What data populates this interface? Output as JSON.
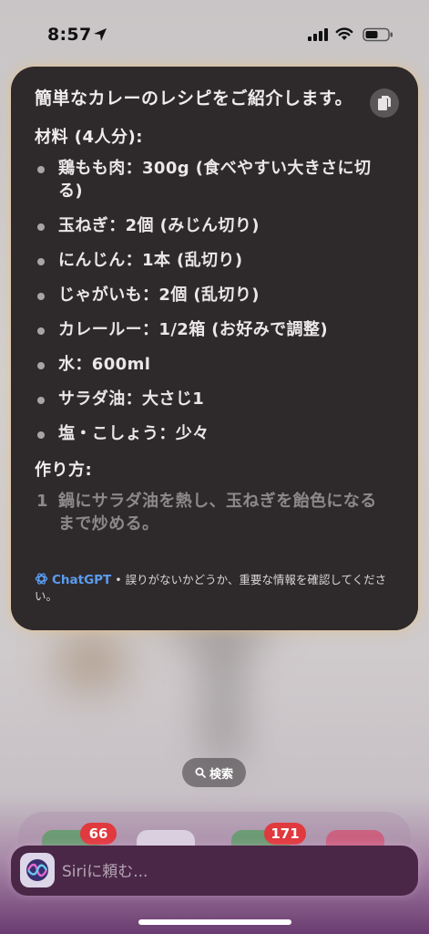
{
  "status_bar": {
    "time": "8:57"
  },
  "response": {
    "intro": "簡単なカレーのレシピをご紹介します。",
    "ingredients_heading": "材料 (4人分):",
    "ingredients": [
      "鶏もも肉：300g (食べやすい大きさに切る)",
      "玉ねぎ：2個 (みじん切り)",
      "にんじん：1本 (乱切り)",
      "じゃがいも：2個 (乱切り)",
      "カレールー：1/2箱 (お好みで調整)",
      "水：600ml",
      "サラダ油：大さじ1",
      "塩・こしょう：少々"
    ],
    "steps_heading": "作り方:",
    "steps": [
      {
        "num": "1",
        "text": "鍋にサラダ油を熱し、玉ねぎを飴色になるまで炒める。"
      }
    ],
    "footer_brand": "ChatGPT",
    "footer_text": " • 誤りがないかどうか、重要な情報を確認してください。"
  },
  "search_pill": {
    "label": "検索"
  },
  "dock": {
    "badges": [
      "66",
      "171"
    ]
  },
  "siri": {
    "placeholder": "Siriに頼む..."
  },
  "colors": {
    "card_bg": "#2e2a2c",
    "brand_blue": "#5b9cf0",
    "badge_red": "#e0393e"
  }
}
